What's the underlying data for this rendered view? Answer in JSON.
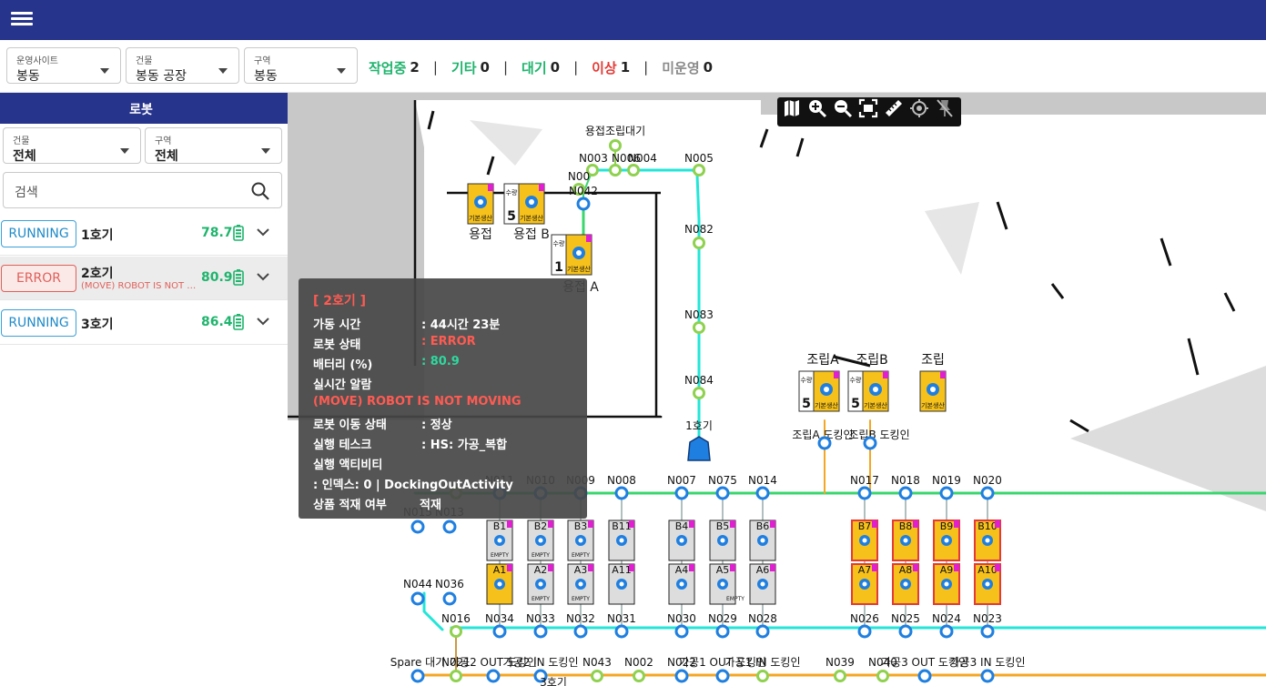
{
  "topbar": {
    "menu_icon": "hamburger-menu-icon"
  },
  "filters": {
    "site": {
      "label": "운영사이트",
      "value": "봉동"
    },
    "building": {
      "label": "건물",
      "value": "봉동 공장"
    },
    "zone": {
      "label": "구역",
      "value": "봉동"
    }
  },
  "status_counts": [
    {
      "label": "작업중",
      "count": "2",
      "color": "#1fb46d"
    },
    {
      "label": "기타",
      "count": "0",
      "color": "#1fb46d"
    },
    {
      "label": "대기",
      "count": "0",
      "color": "#1fb46d"
    },
    {
      "label": "이상",
      "count": "1",
      "color": "#e53935"
    },
    {
      "label": "미운영",
      "count": "0",
      "color": "#8a8a8a"
    }
  ],
  "sidebar": {
    "title": "로봇",
    "building": {
      "label": "건물",
      "value": "전체"
    },
    "zone": {
      "label": "구역",
      "value": "전체"
    },
    "search_placeholder": "검색",
    "robots": [
      {
        "status": "RUNNING",
        "name": "1호기",
        "alarm": "",
        "battery": "78.7"
      },
      {
        "status": "ERROR",
        "name": "2호기",
        "alarm": "(MOVE) ROBOT IS NOT MOVING",
        "battery": "80.9"
      },
      {
        "status": "RUNNING",
        "name": "3호기",
        "alarm": "",
        "battery": "86.4"
      }
    ]
  },
  "tooltip": {
    "title": "[ 2호기 ]",
    "uptime_label": "가동 시간",
    "uptime": ": 44시간 23분",
    "state_label": "로봇 상태",
    "state": ": ERROR",
    "battery_label": "배터리 (%)",
    "battery": ": 80.9",
    "alarm_label": "실시간 알람",
    "alarm": "(MOVE) ROBOT IS NOT MOVING",
    "move_label": "로봇 이동 상태",
    "move": ": 정상",
    "task_label": "실행 테스크",
    "task": ": HS: 가공_복합",
    "activity_label": "실행 액티비티",
    "activity": ": 인덱스: 0 | DockingOutActivity",
    "load_label": "상품 적재 여부",
    "load": "적재"
  },
  "map": {
    "nodes_top": [
      "N003",
      "N006",
      "N004",
      "N005",
      "N00",
      "N042",
      "N082",
      "N083",
      "N084"
    ],
    "labels_top": [
      "용접조립대기",
      "용접",
      "용접 B",
      "용접 A",
      "1호기",
      "조립A",
      "조립B",
      "조립",
      "조립A 도킹인",
      "조립B 도킹인"
    ],
    "row_main": [
      "N011",
      "N010",
      "N009",
      "N008",
      "N007",
      "N075",
      "N014",
      "N017",
      "N018",
      "N019",
      "N020"
    ],
    "row_left": [
      "N015",
      "N013",
      "N044",
      "N036"
    ],
    "row_bottom": [
      "N016",
      "N034",
      "N033",
      "N032",
      "N031",
      "N030",
      "N029",
      "N028",
      "N026",
      "N025",
      "N024",
      "N023"
    ],
    "row_last": [
      "Spare 대기",
      "N021",
      "가공2 OUT 도킹인",
      "가공2 IN 도킹인",
      "N043",
      "N002",
      "N022",
      "가공1 OUT 도킹인",
      "가공1 IN 도킹인",
      "N039",
      "N040",
      "가공3 OUT 도킹인",
      "가공3 IN 도킹인",
      "3호기"
    ],
    "racks_top": [
      "B1",
      "B2",
      "B3",
      "B11",
      "B4",
      "B5",
      "B6",
      "B7",
      "B8",
      "B9",
      "B10"
    ],
    "racks_bottom": [
      "A1",
      "A2",
      "A3",
      "A11",
      "A4",
      "A5",
      "A6",
      "A7",
      "A8",
      "A9",
      "A10"
    ],
    "rack_text": {
      "empty": "EMPTY",
      "count0": "0",
      "count5": "5",
      "count1": "1",
      "qty": "수량",
      "basic": "기본생산"
    }
  }
}
